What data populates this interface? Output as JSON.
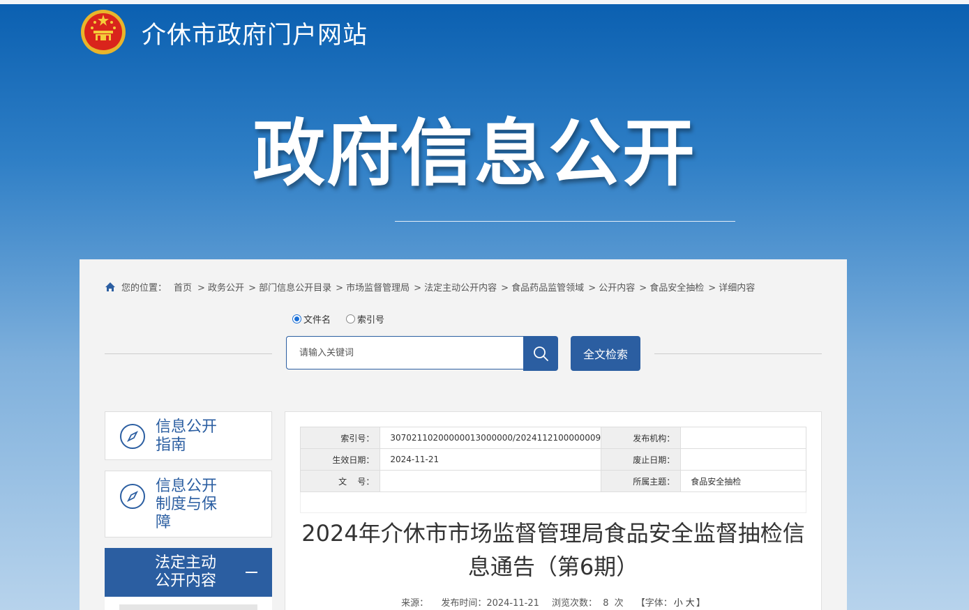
{
  "site": {
    "title": "介休市政府门户网站"
  },
  "banner": {
    "title": "政府信息公开"
  },
  "breadcrumb": {
    "prefix": "您的位置：",
    "items": [
      "首页",
      "> 政务公开",
      "> 部门信息公开目录",
      "> 市场监督管理局",
      "> 法定主动公开内容",
      "> 食品药品监管领域",
      "> 公开内容",
      "> 食品安全抽检",
      "> 详细内容"
    ]
  },
  "search": {
    "radio_filename": "文件名",
    "radio_index": "索引号",
    "placeholder": "请输入关键词",
    "fulltext_label": "全文检索"
  },
  "sidebar": {
    "items": [
      {
        "label": "信息公开指南"
      },
      {
        "label": "信息公开制度与保障"
      },
      {
        "label": "法定主动公开内容"
      }
    ]
  },
  "meta": {
    "index_key": "索引号：",
    "index_val": "30702110200000013000000/2024112100000009",
    "org_key": "发布机构：",
    "org_val": "",
    "eff_key": "生效日期：",
    "eff_val": "2024-11-21",
    "exp_key": "废止日期：",
    "exp_val": "",
    "docno_key": "文    号：",
    "docno_val": "",
    "topic_key": "所属主题：",
    "topic_val": "食品安全抽检"
  },
  "article": {
    "title": "2024年介休市市场监督管理局食品安全监督抽检信息通告（第6期）",
    "source_label": "来源：",
    "time_label": "发布时间：2024-11-21",
    "views_label": "浏览次数：",
    "views": "8",
    "views_unit": "次",
    "font_label": "【字体：",
    "font_small": "小",
    "font_large": "大",
    "font_end": "】"
  },
  "colors": {
    "accent": "#2b5ea1",
    "banner_top": "#0a5fb0"
  }
}
